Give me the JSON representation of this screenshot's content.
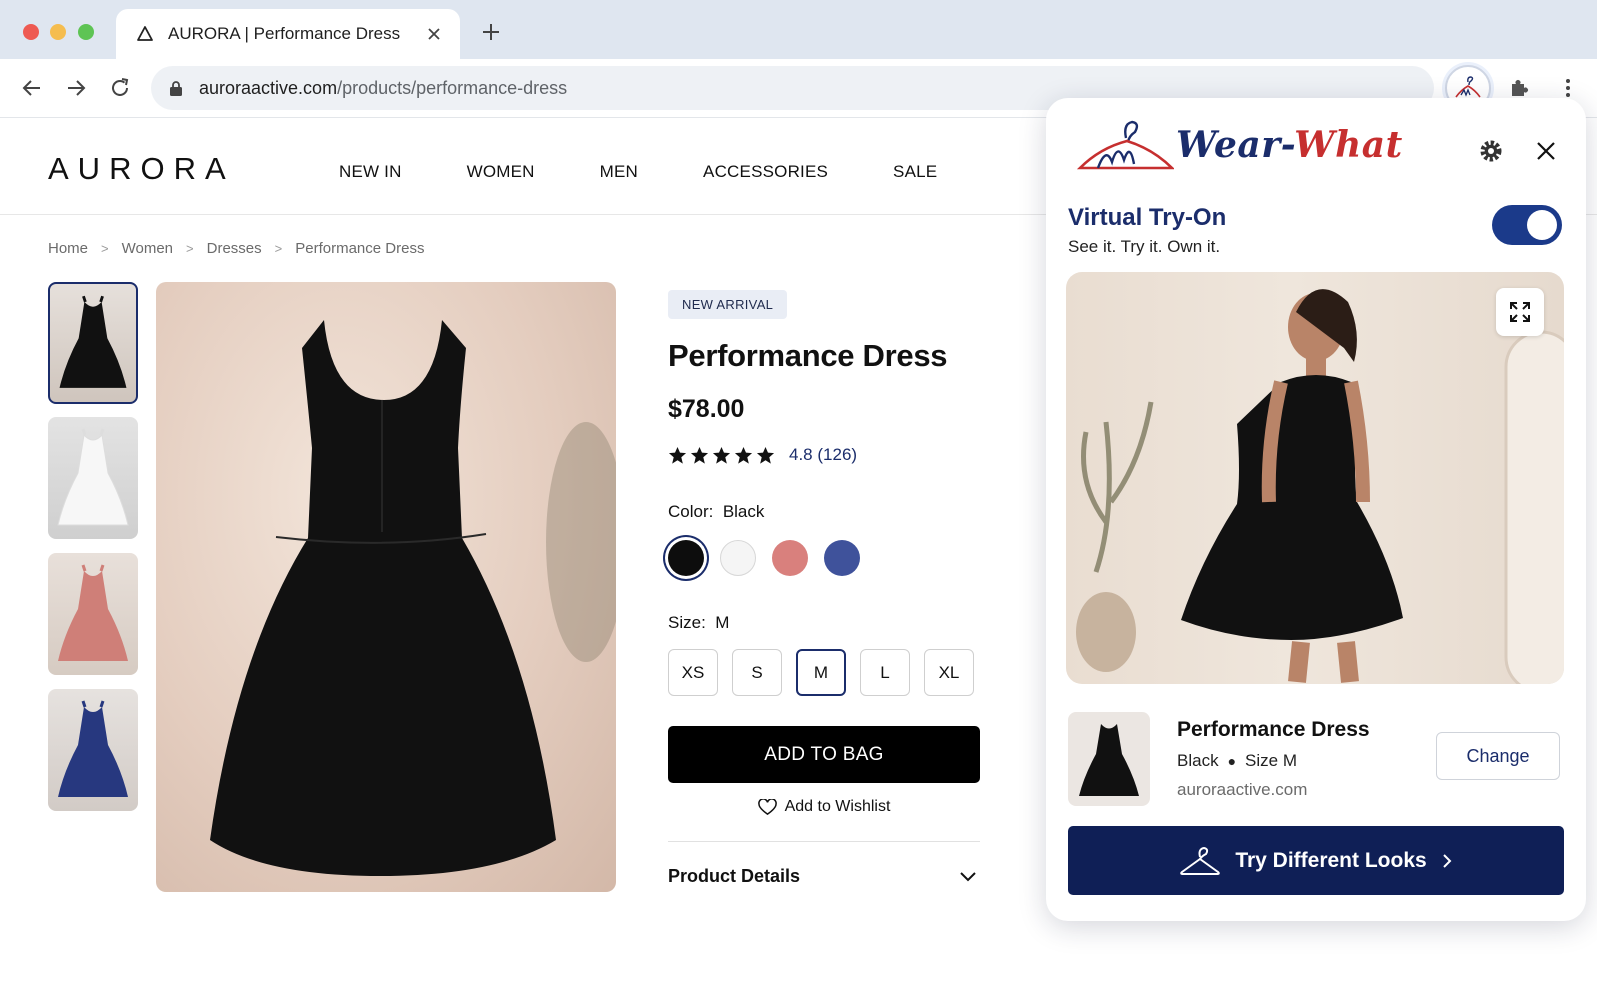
{
  "browser": {
    "tab_title": "AURORA | Performance Dress",
    "url_domain": "auroraactive.com",
    "url_path": "/products/performance-dress"
  },
  "store": {
    "logo": "AURORA",
    "nav": [
      "NEW IN",
      "WOMEN",
      "MEN",
      "ACCESSORIES",
      "SALE"
    ],
    "breadcrumb": [
      "Home",
      "Women",
      "Dresses",
      "Performance Dress"
    ]
  },
  "product": {
    "badge": "NEW ARRIVAL",
    "title": "Performance Dress",
    "price": "$78.00",
    "rating_value": "4.8",
    "rating_count": "(126)",
    "stars": 5,
    "color_label": "Color:",
    "color_value": "Black",
    "colors": [
      {
        "name": "Black",
        "hex": "#0d0d0d"
      },
      {
        "name": "White",
        "hex": "#f5f5f5"
      },
      {
        "name": "Pink",
        "hex": "#d9807d"
      },
      {
        "name": "Blue",
        "hex": "#3f529b"
      }
    ],
    "size_label": "Size:",
    "size_value": "M",
    "sizes": [
      "XS",
      "S",
      "M",
      "L",
      "XL"
    ],
    "selected_size": "M",
    "add_to_bag": "ADD TO BAG",
    "wishlist": "Add to Wishlist",
    "details": "Product Details"
  },
  "extension": {
    "brand_part1": "Wear-",
    "brand_part2": "What",
    "feature_title": "Virtual Try-On",
    "tagline": "See it. Try it. Own it.",
    "toggle_on": true,
    "item_name": "Performance Dress",
    "item_color": "Black",
    "item_size": "Size M",
    "item_site": "auroraactive.com",
    "change_label": "Change",
    "cta_label": "Try Different Looks",
    "accent": "#1b2d6b",
    "brand_red": "#c62f2f"
  },
  "icons": [
    "back-icon",
    "forward-icon",
    "reload-icon",
    "lock-icon",
    "extension-puzzle-icon",
    "menu-icon",
    "gear-icon",
    "close-icon",
    "expand-icon",
    "heart-icon",
    "chevron-down-icon",
    "hanger-icon"
  ]
}
